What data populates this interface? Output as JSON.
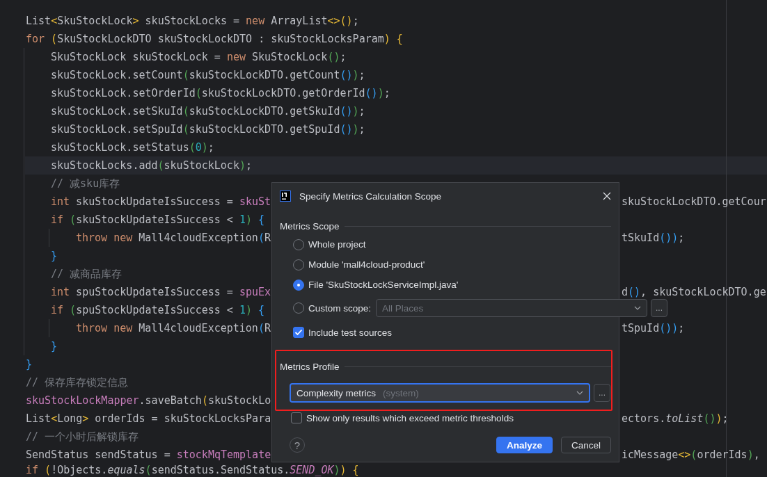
{
  "editor": {
    "lines": [
      {
        "current": false,
        "tokens": [
          {
            "text": "List",
            "kind": "plain"
          },
          {
            "text": "<",
            "kind": "gold"
          },
          {
            "text": "SkuStockLock",
            "kind": "plain"
          },
          {
            "text": ">",
            "kind": "gold"
          },
          {
            "text": " skuStockLocks = ",
            "kind": "plain"
          },
          {
            "text": "new",
            "kind": "keyword"
          },
          {
            "text": " ArrayList",
            "kind": "plain"
          },
          {
            "text": "<>()",
            "kind": "gold"
          },
          {
            "text": ";",
            "kind": "plain"
          }
        ]
      },
      {
        "current": false,
        "tokens": [
          {
            "text": "for",
            "kind": "keyword"
          },
          {
            "text": " (",
            "kind": "gold"
          },
          {
            "text": "SkuStockLockDTO skuStockLockDTO : skuStockLocksParam",
            "kind": "plain"
          },
          {
            "text": ") {",
            "kind": "gold"
          }
        ],
        "children": [
          {
            "current": false,
            "tokens": [
              {
                "text": "SkuStockLock skuStockLock = ",
                "kind": "plain"
              },
              {
                "text": "new",
                "kind": "keyword"
              },
              {
                "text": " SkuStockLock",
                "kind": "plain"
              },
              {
                "text": "()",
                "kind": "green"
              },
              {
                "text": ";",
                "kind": "plain"
              }
            ]
          },
          {
            "current": false,
            "tokens": [
              {
                "text": "skuStockLock.setCount",
                "kind": "plain"
              },
              {
                "text": "(",
                "kind": "green"
              },
              {
                "text": "skuStockLockDTO.getCount",
                "kind": "plain"
              },
              {
                "text": "()",
                "kind": "blue"
              },
              {
                "text": ")",
                "kind": "green"
              },
              {
                "text": ";",
                "kind": "plain"
              }
            ]
          },
          {
            "current": false,
            "tokens": [
              {
                "text": "skuStockLock.setOrderId",
                "kind": "plain"
              },
              {
                "text": "(",
                "kind": "green"
              },
              {
                "text": "skuStockLockDTO.getOrderId",
                "kind": "plain"
              },
              {
                "text": "()",
                "kind": "blue"
              },
              {
                "text": ")",
                "kind": "green"
              },
              {
                "text": ";",
                "kind": "plain"
              }
            ]
          },
          {
            "current": false,
            "tokens": [
              {
                "text": "skuStockLock.setSkuId",
                "kind": "plain"
              },
              {
                "text": "(",
                "kind": "green"
              },
              {
                "text": "skuStockLockDTO.getSkuId",
                "kind": "plain"
              },
              {
                "text": "()",
                "kind": "blue"
              },
              {
                "text": ")",
                "kind": "green"
              },
              {
                "text": ";",
                "kind": "plain"
              }
            ]
          },
          {
            "current": false,
            "tokens": [
              {
                "text": "skuStockLock.setSpuId",
                "kind": "plain"
              },
              {
                "text": "(",
                "kind": "green"
              },
              {
                "text": "skuStockLockDTO.getSpuId",
                "kind": "plain"
              },
              {
                "text": "()",
                "kind": "blue"
              },
              {
                "text": ")",
                "kind": "green"
              },
              {
                "text": ";",
                "kind": "plain"
              }
            ]
          },
          {
            "current": false,
            "tokens": [
              {
                "text": "skuStockLock.setStatus",
                "kind": "plain"
              },
              {
                "text": "(",
                "kind": "green"
              },
              {
                "text": "0",
                "kind": "number"
              },
              {
                "text": ")",
                "kind": "green"
              },
              {
                "text": ";",
                "kind": "plain"
              }
            ]
          },
          {
            "current": true,
            "tokens": [
              {
                "text": "skuStockLocks.add",
                "kind": "plain"
              },
              {
                "text": "(",
                "kind": "green"
              },
              {
                "text": "skuStockLock",
                "kind": "plain"
              },
              {
                "text": ")",
                "kind": "green"
              },
              {
                "text": ";",
                "kind": "plain"
              }
            ]
          },
          {
            "current": false,
            "tokens": [
              {
                "text": "// 减sku库存",
                "kind": "comment"
              }
            ]
          },
          {
            "current": false,
            "tokens": [
              {
                "text": "int",
                "kind": "keyword"
              },
              {
                "text": " skuStockUpdateIsSuccess = ",
                "kind": "plain"
              },
              {
                "text": "skuSt",
                "kind": "field"
              }
            ],
            "right": [
              {
                "text": "skuStockLockDTO.getCour",
                "kind": "plain"
              }
            ]
          },
          {
            "current": false,
            "tokens": [
              {
                "text": "if",
                "kind": "keyword"
              },
              {
                "text": " (",
                "kind": "green"
              },
              {
                "text": "skuStockUpdateIsSuccess < ",
                "kind": "plain"
              },
              {
                "text": "1",
                "kind": "number"
              },
              {
                "text": ")",
                "kind": "green"
              },
              {
                "text": " {",
                "kind": "blue"
              }
            ],
            "children": [
              {
                "current": false,
                "tokens": [
                  {
                    "text": "throw new",
                    "kind": "keyword"
                  },
                  {
                    "text": " Mall4cloudException",
                    "kind": "plain"
                  },
                  {
                    "text": "(",
                    "kind": "blue"
                  },
                  {
                    "text": "R",
                    "kind": "plain"
                  }
                ],
                "right": [
                  {
                    "text": "tSkuId",
                    "kind": "plain"
                  },
                  {
                    "text": "())",
                    "kind": "blue"
                  },
                  {
                    "text": ";",
                    "kind": "plain"
                  }
                ]
              }
            ]
          },
          {
            "current": false,
            "tokens": [
              {
                "text": "}",
                "kind": "blue"
              }
            ]
          },
          {
            "current": false,
            "tokens": [
              {
                "text": "// 减商品库存",
                "kind": "comment"
              }
            ]
          },
          {
            "current": false,
            "tokens": [
              {
                "text": "int",
                "kind": "keyword"
              },
              {
                "text": " spuStockUpdateIsSuccess = ",
                "kind": "plain"
              },
              {
                "text": "spuEx",
                "kind": "field"
              }
            ],
            "right": [
              {
                "text": "d",
                "kind": "plain"
              },
              {
                "text": "()",
                "kind": "blue"
              },
              {
                "text": ", skuStockLockDTO.ge",
                "kind": "plain"
              }
            ]
          },
          {
            "current": false,
            "tokens": [
              {
                "text": "if",
                "kind": "keyword"
              },
              {
                "text": " (",
                "kind": "green"
              },
              {
                "text": "spuStockUpdateIsSuccess < ",
                "kind": "plain"
              },
              {
                "text": "1",
                "kind": "number"
              },
              {
                "text": ")",
                "kind": "green"
              },
              {
                "text": " {",
                "kind": "blue"
              }
            ],
            "children": [
              {
                "current": false,
                "tokens": [
                  {
                    "text": "throw new",
                    "kind": "keyword"
                  },
                  {
                    "text": " Mall4cloudException",
                    "kind": "plain"
                  },
                  {
                    "text": "(",
                    "kind": "blue"
                  },
                  {
                    "text": "R",
                    "kind": "plain"
                  }
                ],
                "right": [
                  {
                    "text": "tSpuId",
                    "kind": "plain"
                  },
                  {
                    "text": "())",
                    "kind": "blue"
                  },
                  {
                    "text": ";",
                    "kind": "plain"
                  }
                ]
              }
            ]
          },
          {
            "current": false,
            "tokens": [
              {
                "text": "}",
                "kind": "blue"
              }
            ]
          }
        ]
      },
      {
        "current": false,
        "tokens": [
          {
            "text": "}",
            "kind": "blue"
          }
        ]
      },
      {
        "current": false,
        "tokens": [
          {
            "text": "// 保存库存锁定信息",
            "kind": "comment"
          }
        ]
      },
      {
        "current": false,
        "tokens": [
          {
            "text": "skuStockLockMapper",
            "kind": "field"
          },
          {
            "text": ".saveBatch",
            "kind": "plain"
          },
          {
            "text": "(",
            "kind": "gold"
          },
          {
            "text": "skuStockLo",
            "kind": "plain"
          }
        ]
      },
      {
        "current": false,
        "tokens": [
          {
            "text": "List",
            "kind": "plain"
          },
          {
            "text": "<",
            "kind": "gold"
          },
          {
            "text": "Long",
            "kind": "plain"
          },
          {
            "text": ">",
            "kind": "gold"
          },
          {
            "text": " orderIds = skuStockLocksPara",
            "kind": "plain"
          }
        ],
        "right": [
          {
            "text": "ectors.",
            "kind": "plain"
          },
          {
            "text": "toList",
            "kind": "italic"
          },
          {
            "text": "()",
            "kind": "green"
          },
          {
            "text": ")",
            "kind": "gold"
          },
          {
            "text": ";",
            "kind": "plain"
          }
        ]
      },
      {
        "current": false,
        "tokens": [
          {
            "text": "// 一个小时后解锁库存",
            "kind": "comment"
          }
        ]
      },
      {
        "current": false,
        "tokens": [
          {
            "text": "SendStatus sendStatus = ",
            "kind": "plain"
          },
          {
            "text": "stockMqTemplate",
            "kind": "field"
          }
        ],
        "right": [
          {
            "text": "icMessage",
            "kind": "plain"
          },
          {
            "text": "<>",
            "kind": "gold"
          },
          {
            "text": "(",
            "kind": "green"
          },
          {
            "text": "orderIds",
            "kind": "plain"
          },
          {
            "text": ")",
            "kind": "green"
          },
          {
            "text": ",",
            "kind": "plain"
          }
        ]
      },
      {
        "current": false,
        "tokens": [
          {
            "text": "if",
            "kind": "keyword"
          },
          {
            "text": " (",
            "kind": "gold"
          },
          {
            "text": "!Objects.",
            "kind": "plain"
          },
          {
            "text": "equals",
            "kind": "italic"
          },
          {
            "text": "(",
            "kind": "green"
          },
          {
            "text": "sendStatus.SendStatus.",
            "kind": "plain"
          },
          {
            "text": "SEND_OK",
            "kind": "field_italic"
          },
          {
            "text": ")",
            "kind": "green"
          },
          {
            "text": ") {",
            "kind": "gold"
          }
        ]
      }
    ]
  },
  "dialog": {
    "title": "Specify Metrics Calculation Scope",
    "sections": [
      {
        "heading": "Metrics Scope",
        "options": [
          {
            "kind": "radio",
            "label": "Whole project",
            "selected": false
          },
          {
            "kind": "radio",
            "label": "Module 'mall4cloud-product'",
            "selected": false
          },
          {
            "kind": "radio",
            "label": "File 'SkuStockLockServiceImpl.java'",
            "selected": true
          },
          {
            "kind": "radio",
            "label": "Custom scope:",
            "selected": false,
            "dropdown": {
              "value": "All Places",
              "disabled": true,
              "browse": "..."
            }
          },
          {
            "kind": "checkbox",
            "label": "Include test sources",
            "checked": true
          }
        ]
      },
      {
        "heading": "Metrics Profile",
        "options": [
          {
            "kind": "dropdown",
            "value": "Complexity metrics",
            "hint": "(system)",
            "focused": true,
            "browse": "..."
          },
          {
            "kind": "checkbox",
            "label": "Show only results which exceed metric thresholds",
            "checked": false
          }
        ]
      }
    ],
    "help": "?",
    "buttons": [
      {
        "label": "Analyze",
        "primary": true
      },
      {
        "label": "Cancel",
        "primary": false
      }
    ],
    "annotations": [
      {
        "kind": "rectangle"
      }
    ]
  }
}
